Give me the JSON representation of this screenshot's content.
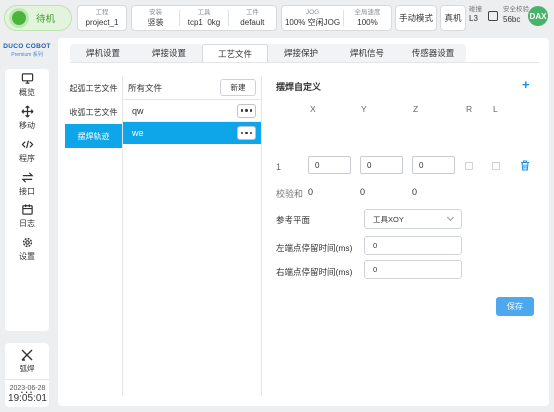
{
  "topbar": {
    "status": "待机",
    "project_label": "工程",
    "project_value": "project_1",
    "install_label": "安装",
    "install_value": "竖装",
    "tool_label": "工具",
    "tool_value": "tcp1",
    "tool_weight": "0kg",
    "workpiece_label": "工件",
    "workpiece_value": "default",
    "jog_label": "JOG",
    "jog_value": "100%",
    "jog_mode": "空闲JOG",
    "speed_label": "全局速度",
    "speed_value": "100%",
    "mode_button": "手动模式",
    "real_button": "真机",
    "link_label": "碰撞",
    "link_value": "L3",
    "safety_label": "安全校验",
    "safety_value": "56bc",
    "user_initials": "DAX"
  },
  "sidebar": {
    "logo_line1": "DUCO COBOT",
    "logo_line2": "Premium 系列",
    "items": [
      {
        "label": "概览",
        "icon": "monitor-icon"
      },
      {
        "label": "移动",
        "icon": "move-icon"
      },
      {
        "label": "程序",
        "icon": "code-icon"
      },
      {
        "label": "接口",
        "icon": "exchange-icon"
      },
      {
        "label": "日志",
        "icon": "calendar-icon"
      },
      {
        "label": "设置",
        "icon": "gear-icon"
      }
    ],
    "extra_label": "弧焊",
    "more_label": "..."
  },
  "clock": {
    "date": "2023-06-28",
    "time": "19:05:01"
  },
  "tabs": [
    "焊机设置",
    "焊接设置",
    "工艺文件",
    "焊接保护",
    "焊机信号",
    "传感器设置"
  ],
  "active_tab": 2,
  "file_types": [
    "起弧工艺文件",
    "收弧工艺文件",
    "摆焊轨迹"
  ],
  "active_type": 2,
  "files": {
    "header": "所有文件",
    "new_button": "新建",
    "items": [
      "qw",
      "we"
    ],
    "active_item": 1
  },
  "panel": {
    "title": "摆焊自定义",
    "add_icon": "+",
    "columns": [
      "X",
      "Y",
      "Z",
      "R",
      "L"
    ],
    "rows": [
      {
        "index": "1",
        "x": "0",
        "y": "0",
        "z": "0"
      }
    ],
    "checksum_label": "校验和",
    "checksum": [
      "0",
      "0",
      "0"
    ],
    "ref_plane_label": "参考平面",
    "ref_plane_value": "工具XOY",
    "left_dwell_label": "左端点停留时间(ms)",
    "left_dwell_value": "0",
    "right_dwell_label": "右端点停留时间(ms)",
    "right_dwell_value": "0",
    "save_button": "保存"
  },
  "colors": {
    "accent": "#0ea6e9",
    "save": "#4da8ee",
    "status_green": "#49b53a"
  }
}
